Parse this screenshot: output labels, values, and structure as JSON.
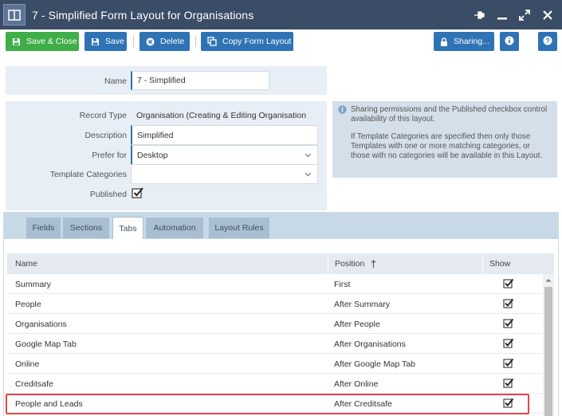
{
  "window": {
    "title": "7 - Simplified Form Layout for Organisations",
    "controls": [
      "pin-icon",
      "minimize-icon",
      "expand-icon",
      "close-icon"
    ]
  },
  "toolbar": {
    "save_close": "Save & Close",
    "save": "Save",
    "delete": "Delete",
    "copy_layout": "Copy Form Layout",
    "sharing": "Sharing...",
    "info_icon": "info-icon",
    "help_icon": "help-icon"
  },
  "form": {
    "name_label": "Name",
    "name_value": "7 - Simplified",
    "record_type_label": "Record Type",
    "record_type_value": "Organisation (Creating & Editing Organisation",
    "description_label": "Description",
    "description_value": "Simplified",
    "prefer_for_label": "Prefer for",
    "prefer_for_value": "Desktop",
    "template_categories_label": "Template Categories",
    "template_categories_value": "",
    "published_label": "Published",
    "published_checked": true
  },
  "info": {
    "p1": "Sharing permissions and the Published checkbox control availability of this layout.",
    "p2": "If Template Categories are specified then only those Templates with one or more matching categories, or those with no categories will be available in this Layout."
  },
  "tabs": {
    "items": [
      "Fields",
      "Sections",
      "Tabs",
      "Automation",
      "Layout Rules"
    ],
    "active": "Tabs"
  },
  "grid": {
    "headers": {
      "name": "Name",
      "position": "Position",
      "show": "Show"
    },
    "sorted_by": "Position",
    "rows": [
      {
        "name": "Summary",
        "position": "First",
        "show": true
      },
      {
        "name": "People",
        "position": "After Summary",
        "show": true
      },
      {
        "name": "Organisations",
        "position": "After People",
        "show": true
      },
      {
        "name": "Google Map Tab",
        "position": "After Organisations",
        "show": true
      },
      {
        "name": "Online",
        "position": "After Google Map Tab",
        "show": true
      },
      {
        "name": "Creditsafe",
        "position": "After Online",
        "show": true
      },
      {
        "name": "People and Leads",
        "position": "After Creditsafe",
        "show": true
      }
    ],
    "highlighted_row": "People and Leads"
  },
  "colors": {
    "titlebar": "#3a4c66",
    "accent_blue": "#2f73b5",
    "accent_green": "#3fae49",
    "highlight": "#e0484b"
  }
}
